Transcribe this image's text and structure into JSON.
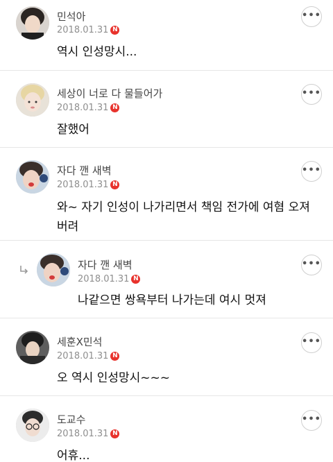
{
  "comments": [
    {
      "author": "민석아",
      "date": "2018.01.31",
      "badge": "N",
      "text": "역시 인성망시...",
      "more_icon": "more-horizontal-icon"
    },
    {
      "author": "세상이 너로 다 물들어가",
      "date": "2018.01.31",
      "badge": "N",
      "text": "잘했어",
      "more_icon": "more-horizontal-icon"
    },
    {
      "author": "자다 깬 새벽",
      "date": "2018.01.31",
      "badge": "N",
      "text": "와~ 자기 인성이 나가리면서 책임 전가에 여혐 오져버려",
      "more_icon": "more-horizontal-icon"
    },
    {
      "author": "자다 깬 새벽",
      "date": "2018.01.31",
      "badge": "N",
      "text": "나같으면 쌍욕부터 나가는데 여시 멋져",
      "is_reply": true,
      "reply_icon": "reply-arrow-icon",
      "more_icon": "more-horizontal-icon"
    },
    {
      "author": "세훈X민석",
      "date": "2018.01.31",
      "badge": "N",
      "text": "오 역시 인성망시~~~",
      "more_icon": "more-horizontal-icon"
    },
    {
      "author": "도교수",
      "date": "2018.01.31",
      "badge": "N",
      "text": "어휴...",
      "more_icon": "more-horizontal-icon"
    }
  ],
  "more_label": "•••",
  "colors": {
    "badge": "#e8322c",
    "divider": "#e6e6e6",
    "meta": "#8e8e8e"
  }
}
